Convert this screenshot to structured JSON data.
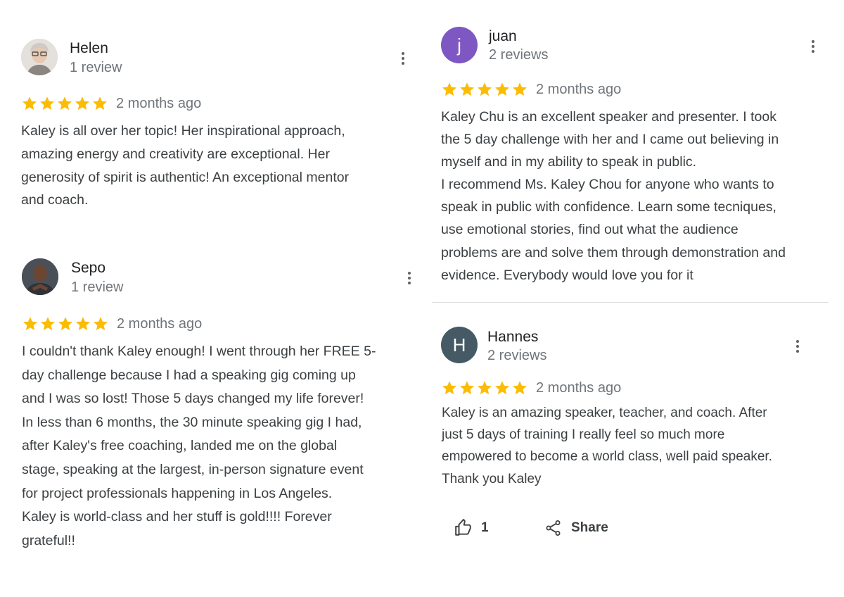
{
  "colors": {
    "star": "#fbbc04",
    "avatar_juan": "#7e57c2",
    "avatar_hannes": "#455a64"
  },
  "reviews": [
    {
      "name": "Helen",
      "count": "1 review",
      "rating": 5,
      "date": "2 months ago",
      "text": "Kaley is all over her topic! Her inspirational approach,\namazing energy and creativity are exceptional. Her\ngenerosity of spirit is authentic! An exceptional mentor\nand coach.",
      "avatar": "photo"
    },
    {
      "name": "Sepo",
      "count": "1 review",
      "rating": 5,
      "date": "2 months ago",
      "text": "I couldn't thank Kaley enough! I went through her FREE 5-\nday challenge because I had a speaking gig coming up\nand I was so lost! Those 5 days changed my life forever!\nIn less than 6 months, the 30 minute speaking gig I had,\nafter Kaley's free coaching, landed me on the global\nstage, speaking at the largest, in-person signature event\nfor project professionals happening in Los Angeles.\nKaley is world-class and her stuff is gold!!!! Forever\ngrateful!!",
      "avatar": "photo"
    },
    {
      "name": "juan",
      "count": "2 reviews",
      "rating": 5,
      "date": "2 months ago",
      "text": "Kaley Chu is an excellent speaker and presenter. I took\nthe 5 day challenge with her and I came out believing in\nmyself and in my ability to speak in public.\nI recommend Ms. Kaley Chou for anyone who wants to\nspeak in public with confidence. Learn some tecniques,\nuse emotional stories, find out what the audience\nproblems are and solve them through demonstration and\nevidence. Everybody would love you for it",
      "avatar": "letter",
      "initial": "j"
    },
    {
      "name": "Hannes",
      "count": "2 reviews",
      "rating": 5,
      "date": "2 months ago",
      "text": "Kaley is an amazing speaker, teacher, and coach. After\njust 5 days of training I really feel so much more\nempowered to become a world class, well paid speaker.\nThank you Kaley",
      "avatar": "letter",
      "initial": "H",
      "like_count": "1",
      "share_label": "Share"
    }
  ]
}
